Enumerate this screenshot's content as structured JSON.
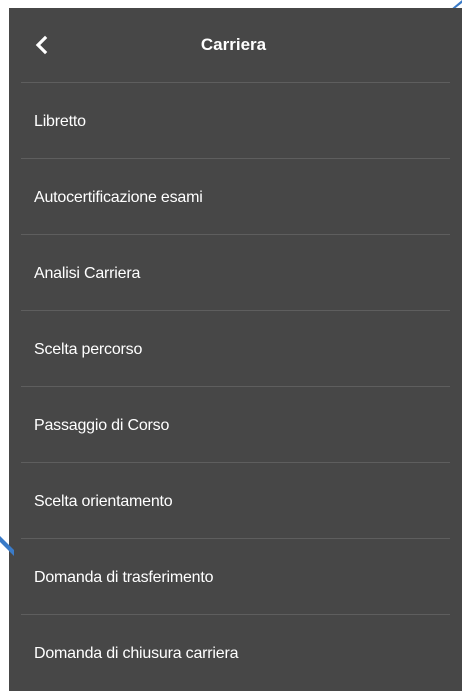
{
  "header": {
    "title": "Carriera",
    "back_icon": "chevron-left-icon"
  },
  "menu": {
    "items": [
      {
        "label": "Libretto"
      },
      {
        "label": "Autocertificazione esami"
      },
      {
        "label": "Analisi Carriera"
      },
      {
        "label": "Scelta percorso"
      },
      {
        "label": "Passaggio di Corso"
      },
      {
        "label": "Scelta orientamento"
      },
      {
        "label": "Domanda di trasferimento"
      },
      {
        "label": "Domanda di chiusura carriera"
      }
    ]
  },
  "colors": {
    "panel_background": "#474747",
    "divider": "#5e5e5e",
    "text": "#ffffff",
    "annotation_arrow": "#3a7bc8"
  }
}
